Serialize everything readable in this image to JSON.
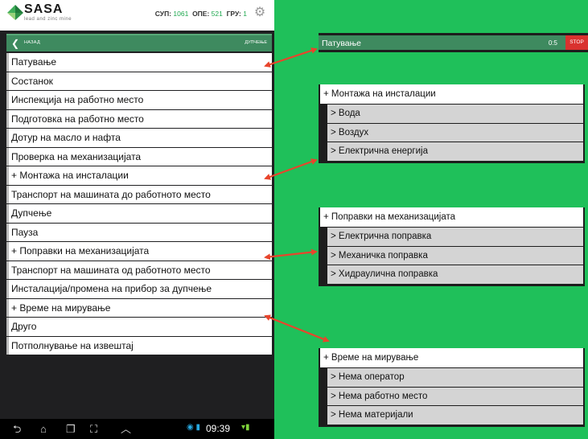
{
  "header": {
    "brand": "SASA",
    "tagline": "lead and zinc mine",
    "counters": [
      {
        "label": "СУП:",
        "value": "1061"
      },
      {
        "label": "ОПЕ:",
        "value": "521"
      },
      {
        "label": "ГРУ:",
        "value": "1"
      }
    ],
    "settings_icon": "gear-icon"
  },
  "navbar": {
    "back_label": "НАЗАД",
    "title": "ДУПЧЕЊЕ"
  },
  "activities": [
    "Патување",
    "Состанок",
    "Инспекција на работно место",
    "Подготовка на работно место",
    "Дотур на масло и нафта",
    "Проверка на механизацијата",
    "+ Монтажа на инсталации",
    "Транспорт на машината до работното место",
    "Дупчење",
    "Пауза",
    "+ Поправки на механизацијата",
    "Транспорт на машината од работното место",
    "Инсталација/промена на прибор за дупчење",
    "+ Време на мирување",
    "Друго",
    "Потполнување на извештај"
  ],
  "system_bar": {
    "time": "09:39",
    "icons": [
      "back-icon",
      "home-icon",
      "recent-apps-icon",
      "screenshot-icon",
      "chevron-up-icon"
    ]
  },
  "running_activity": {
    "label": "Патување",
    "timer": "0:5",
    "stop_label": "STOP",
    "stop_color": "#d9322f"
  },
  "expanded_groups": [
    {
      "title": "+ Монтажа на инсталации",
      "items": [
        "> Вода",
        "> Воздух",
        "> Електрична енергија"
      ]
    },
    {
      "title": "+ Поправки на механизацијата",
      "items": [
        "> Електрична поправка",
        "> Механичка поправка",
        "> Хидраулична поправка"
      ]
    },
    {
      "title": "+ Време на мирување",
      "items": [
        "> Нема оператор",
        "> Нема работно место",
        "> Нема материјали"
      ]
    }
  ],
  "colors": {
    "background": "#1fc05a",
    "accent_bar": "#3e8a5f",
    "arrow": "#e8452c",
    "subitem": "#d4d4d4"
  }
}
